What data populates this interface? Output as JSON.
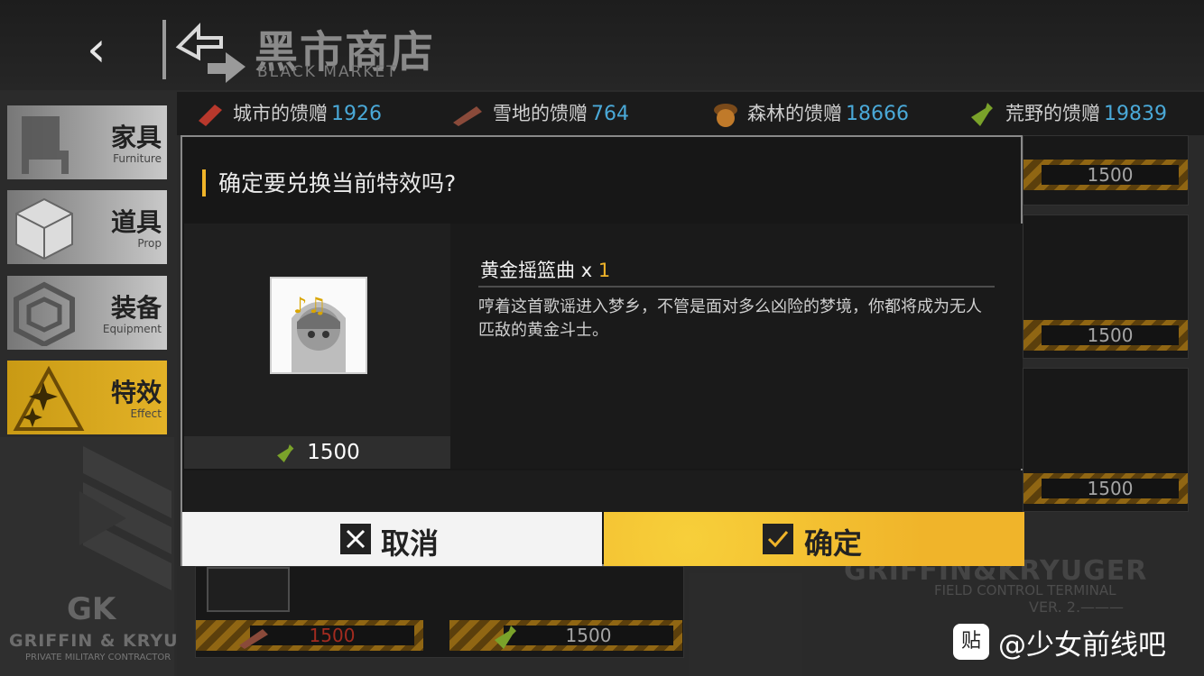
{
  "header": {
    "back_icon": "back-chevron-icon",
    "title_cn": "黑市商店",
    "title_en": "BLACK MARKET"
  },
  "sidebar": {
    "items": [
      {
        "cn": "家具",
        "en": "Furniture",
        "icon": "chair-icon",
        "active": false
      },
      {
        "cn": "道具",
        "en": "Prop",
        "icon": "box-icon",
        "active": false
      },
      {
        "cn": "装备",
        "en": "Equipment",
        "icon": "cube-icon",
        "active": false
      },
      {
        "cn": "特效",
        "en": "Effect",
        "icon": "sparkle-icon",
        "active": true
      }
    ],
    "deco_brand": "GRIFFIN & KRYUGER",
    "deco_sub": "PRIVATE MILITARY CONTRACTOR",
    "deco_gk": "GK"
  },
  "currencies": [
    {
      "label": "城市的馈赠",
      "value": "1926",
      "icon": "brick-icon",
      "color": "#b8382c"
    },
    {
      "label": "雪地的馈赠",
      "value": "764",
      "icon": "log-icon",
      "color": "#8a4a3a"
    },
    {
      "label": "森林的馈赠",
      "value": "18666",
      "icon": "acorn-icon",
      "color": "#9a5a22"
    },
    {
      "label": "荒野的馈赠",
      "value": "19839",
      "icon": "bottle-icon",
      "color": "#7aa22a"
    }
  ],
  "grid_prices": {
    "right_col": [
      "1500",
      "1500",
      "1500"
    ],
    "bottom_row": [
      "1500",
      "1500"
    ],
    "bottom_left_color": "#d83a2a"
  },
  "watermark": {
    "brand": "GRIFFIN&KRYUGER",
    "line2": "FIELD CONTROL TERMINAL",
    "line3": "VER. 2.———"
  },
  "overlay": {
    "badge": "贴",
    "text": "@少女前线吧"
  },
  "modal": {
    "title": "确定要兑换当前特效吗?",
    "item_name": "黄金摇篮曲",
    "item_qty_prefix": "x",
    "item_qty": "1",
    "item_desc": "哼着这首歌谣进入梦乡，不管是面对多么凶险的梦境，你都将成为无人匹敌的黄金斗士。",
    "cost": "1500",
    "cost_icon": "bottle-icon",
    "cancel_label": "取消",
    "cancel_icon": "close-box-icon",
    "ok_label": "确定",
    "ok_icon": "check-box-icon",
    "accent": "#f0b429"
  }
}
